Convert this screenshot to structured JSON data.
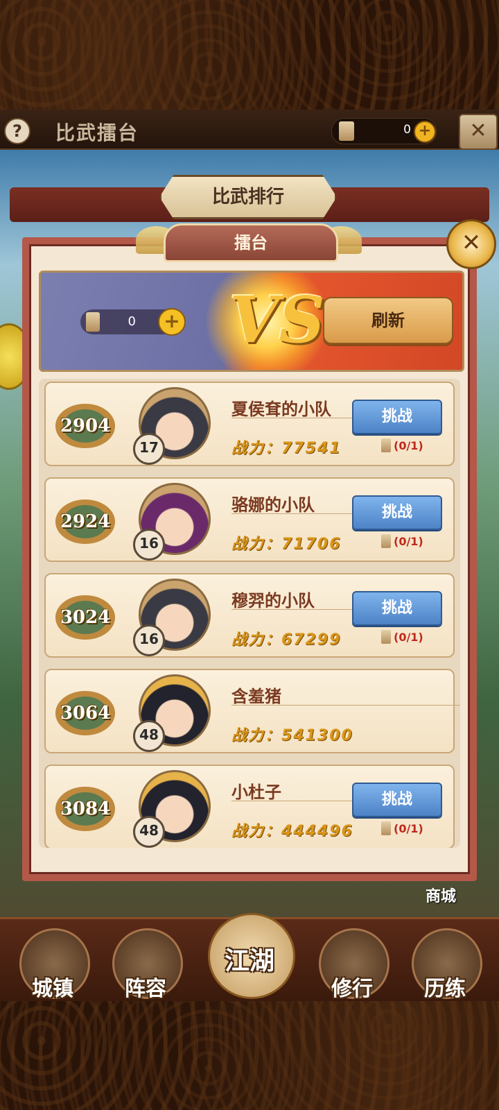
{
  "header": {
    "help_icon": "?",
    "title": "比武擂台",
    "currency_value": "0",
    "plus_icon": "+",
    "close_icon": "✕"
  },
  "tabs": {
    "rank": "比武排行",
    "arena": "擂台"
  },
  "banner": {
    "currency_value": "0",
    "plus_icon": "+",
    "vs_text": "VS",
    "refresh_label": "刷新"
  },
  "players": [
    {
      "score": "2904",
      "level": "17",
      "name": "夏侯耷的小队",
      "power": "战力：77541",
      "challenge_label": "挑战",
      "attempts": "(0/1)"
    },
    {
      "score": "2924",
      "level": "16",
      "name": "骆娜的小队",
      "power": "战力：71706",
      "challenge_label": "挑战",
      "attempts": "(0/1)"
    },
    {
      "score": "3024",
      "level": "16",
      "name": "穆羿的小队",
      "power": "战力：67299",
      "challenge_label": "挑战",
      "attempts": "(0/1)"
    },
    {
      "score": "3064",
      "level": "48",
      "name": "含羞猪",
      "power": "战力：541300"
    },
    {
      "score": "3084",
      "level": "48",
      "name": "小杜子",
      "power": "战力：444496",
      "challenge_label": "挑战",
      "attempts": "(0/1)"
    }
  ],
  "nav": {
    "town": "城镇",
    "lineup": "阵容",
    "jianghu": "江湖",
    "cultivate": "修行",
    "trial": "历练",
    "shop": "商城"
  },
  "colors": {
    "panel_border": "#b4584a",
    "challenge_button": "#4d83c7",
    "refresh_button": "#d99b4a",
    "power_text": "#d9961a"
  }
}
